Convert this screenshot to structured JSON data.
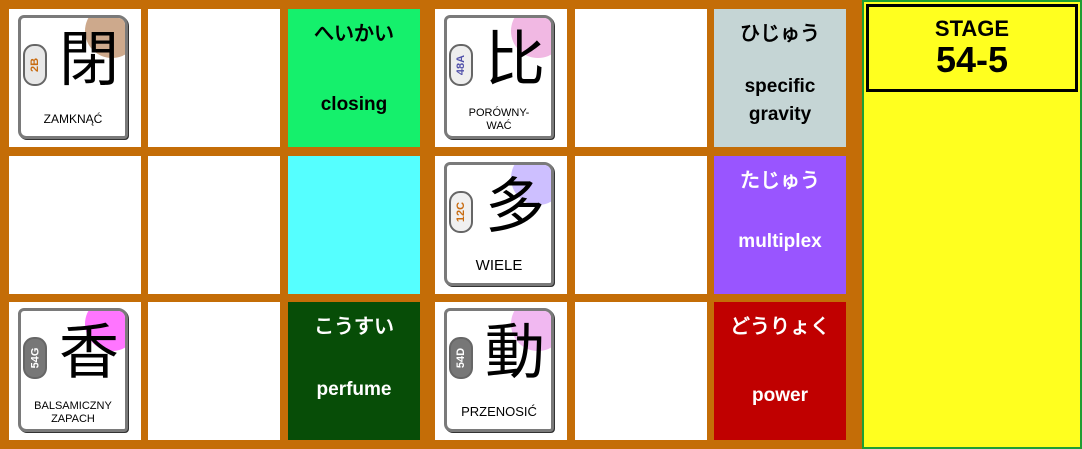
{
  "board": {
    "colors": {
      "border": "#c46d07",
      "closing_card": "#15f06c",
      "cyan_tile": "#55ffff",
      "perfume_card": "#074d07",
      "specific_gravity_card": "#c5d5d5",
      "multiplex_card": "#9955ff",
      "power_card": "#c00000"
    },
    "kanji_cards": [
      {
        "kanji": "閉",
        "code": "2B",
        "meaning": "ZAMKNĄĆ",
        "blob_color": "#e8e8e8",
        "code_color": "#c86b10",
        "corner_color": "#c8a080"
      },
      {
        "kanji": "比",
        "code": "48A",
        "meaning": "PORÓWNY-\nWAĆ",
        "blob_color": "#eeeeee",
        "code_color": "#5050aa",
        "corner_color": "#f0b0e0"
      },
      {
        "kanji": "多",
        "code": "12C",
        "meaning": "WIELE",
        "blob_color": "#f0f0f0",
        "code_color": "#c86b10",
        "corner_color": "#c8b8ff"
      },
      {
        "kanji": "香",
        "code": "54G",
        "meaning": "BALSAMICZNY\nZAPACH",
        "blob_color": "#777777",
        "code_color": "#ffffff",
        "corner_color": "#ff66ff"
      },
      {
        "kanji": "動",
        "code": "54D",
        "meaning": "PRZENOSIĆ",
        "blob_color": "#777777",
        "code_color": "#ffffff",
        "corner_color": "#f0b0f0"
      }
    ],
    "words": {
      "closing": {
        "reading": "へいかい",
        "translation": "closing"
      },
      "perfume": {
        "reading": "こうすい",
        "translation": "perfume"
      },
      "specific_gravity": {
        "reading": "ひじゅう",
        "translation": "specific\ngravity"
      },
      "multiplex": {
        "reading": "たじゅう",
        "translation": "multiplex"
      },
      "power": {
        "reading": "どうりょく",
        "translation": "power"
      }
    }
  },
  "stage": {
    "label": "STAGE",
    "value": "54-5"
  }
}
